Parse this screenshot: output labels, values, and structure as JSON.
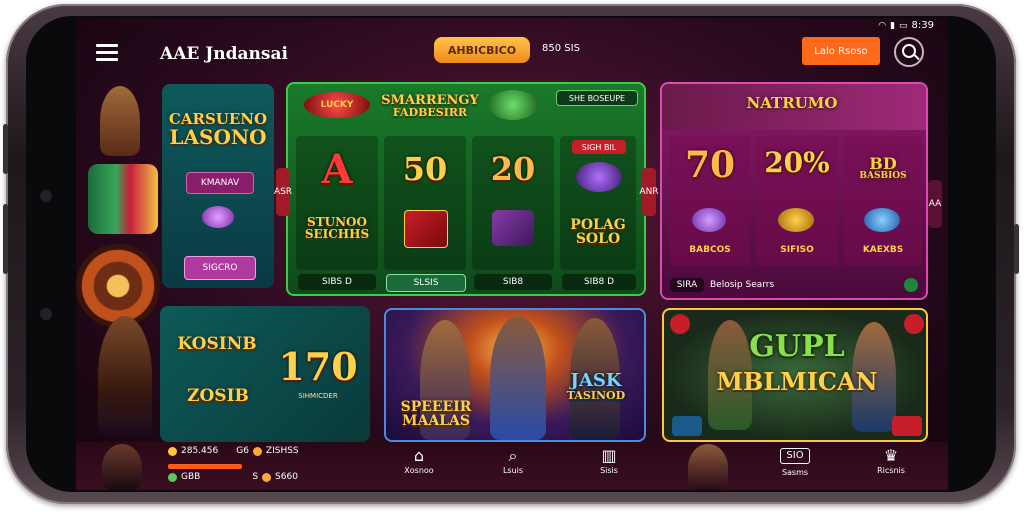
{
  "status_bar": {
    "time": "8:39",
    "icons": [
      "wifi-icon",
      "signal-icon",
      "battery-icon"
    ]
  },
  "header": {
    "title": "AAE Jndansai",
    "promo_label": "AHBICBICO",
    "balance": "850 SIS",
    "login_label": "Lalo Rsoso"
  },
  "cards": {
    "casino_lasono": {
      "title_line1": "CARSUENO",
      "title_line2": "LASONO",
      "badge": "KMANAV",
      "button": "SIGCRO"
    },
    "slots": {
      "logo": "LUCKY",
      "title_line1": "SMARRENGY",
      "title_line2": "FADBESIRR",
      "top_right_tag": "SHE BOSEUPE",
      "sym_a": "A",
      "sym_50": "50",
      "sym_20": "20",
      "sig": "SIGH BIL",
      "label_stuno": "STUNOO",
      "label_stuno2": "SEICHHS",
      "label_polag": "POLAG",
      "label_polag2": "SOLO",
      "footer_1": "SIBS D",
      "footer_2": "SLSIS",
      "footer_3": "SIB8",
      "footer_4": "SIB8 D",
      "arrow_left": "ASR",
      "arrow_right": "ANR"
    },
    "natrumo": {
      "title": "NATRUMO",
      "val_70": "70",
      "val_20": "20%",
      "bd_line1": "BD",
      "bd_line2": "BASBIOS",
      "lbl_1": "BABCOS",
      "lbl_2": "SIFISO",
      "lbl_3": "KAEXBS",
      "footer_left": "SIRA",
      "footer_text": "Belosip Searrs",
      "side_arrow": "AA"
    },
    "kosinb": {
      "title1": "KOSINB",
      "title2": "ZOSIB",
      "value": "170",
      "sub": "SIHMICDER"
    },
    "speeir": {
      "line1": "SPEEEIR",
      "line2": "MAALAS",
      "jask1": "JASK",
      "jask2": "TASINOD"
    },
    "gupl": {
      "line1": "GUPL",
      "line2": "MBLMICAN"
    }
  },
  "bottom_nav": {
    "stats": [
      {
        "value": "285.456",
        "extra": "G6",
        "tag": "ZISHSS"
      },
      {
        "value": "GBB",
        "extra": "S",
        "tag": "S660"
      }
    ],
    "stat_fill_fraction": 0.86,
    "items": [
      {
        "label": "Xosnoo",
        "icon": "home-icon"
      },
      {
        "label": "Lsuis",
        "icon": "search-icon"
      },
      {
        "label": "Sisis",
        "icon": "wallet-icon"
      },
      {
        "label": "Sasms",
        "icon": "promo-icon"
      },
      {
        "label": "Ricsnis",
        "icon": "profile-icon"
      }
    ],
    "promo_badge": "SIO"
  }
}
